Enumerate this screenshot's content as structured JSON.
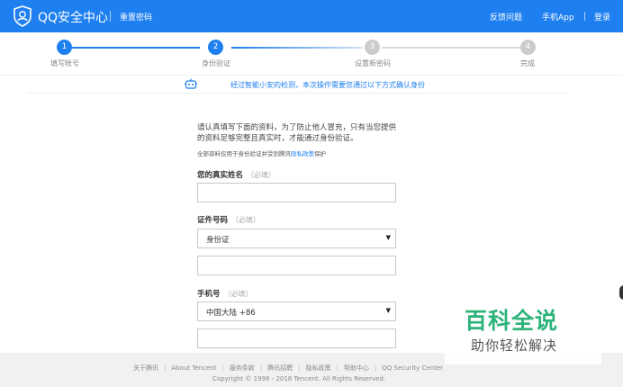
{
  "header": {
    "brand": "QQ安全中心",
    "page_title": "重置密码",
    "nav": {
      "feedback": "反馈问题",
      "mobile_app": "手机App",
      "login": "登录"
    }
  },
  "steps": [
    {
      "num": "1",
      "label": "填写帐号",
      "state": "done"
    },
    {
      "num": "2",
      "label": "身份验证",
      "state": "active"
    },
    {
      "num": "3",
      "label": "设置新密码",
      "state": "todo"
    },
    {
      "num": "4",
      "label": "完成",
      "state": "todo"
    }
  ],
  "notice": "经过智能小安的检测，本次操作需要您通过以下方式确认身份",
  "form": {
    "intro_line1": "请认真填写下面的资料，为了防止他人冒充，只有当您提供",
    "intro_line2": "的资料足够完整且真实时，才能通过身份验证。",
    "privacy_prefix": "全部资料仅用于身份验证并受到腾讯",
    "privacy_link": "隐私政策",
    "privacy_suffix": "保护",
    "name_label": "您的真实姓名",
    "name_required": "（必填）",
    "name_value": "",
    "id_label": "证件号码",
    "id_required": "（必填）",
    "id_type": "身份证",
    "id_value": "",
    "phone_label": "手机号",
    "phone_required": "（必填）",
    "phone_region": "中国大陆 +86",
    "phone_value": ""
  },
  "footer": {
    "links": [
      "关于腾讯",
      "About Tencent",
      "服务条款",
      "腾讯招聘",
      "隐私政策",
      "帮助中心",
      "QQ Security Center"
    ],
    "copyright": "Copyright © 1998 - 2018 Tencent. All Rights Reserved."
  },
  "watermark": {
    "big": "百科全说",
    "small": "助你轻松解决"
  },
  "colors": {
    "brand_blue": "#1e7ff0",
    "inactive": "#cccccc",
    "watermark_green": "#2db37a"
  }
}
